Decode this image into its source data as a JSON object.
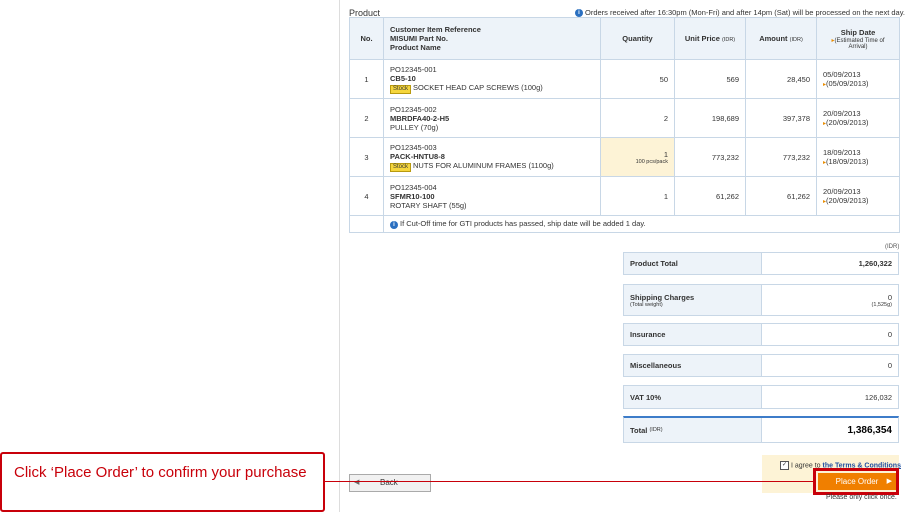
{
  "section_title": "Product",
  "notice": "Orders received after 16:30pm (Mon-Fri) and after 14pm (Sat) will be processed on the next day.",
  "table": {
    "headers": {
      "no": "No.",
      "ref_line1": "Customer Item Reference",
      "ref_line2": "MISUMI Part No.",
      "ref_line3": "Product Name",
      "quantity": "Quantity",
      "unit_price": "Unit Price",
      "unit_price_unit": "(IDR)",
      "amount": "Amount",
      "amount_unit": "(IDR)",
      "ship_date": "Ship Date",
      "ship_date_note": "(Estimated Time of Arrival)"
    },
    "rows": [
      {
        "no": "1",
        "ref": "PO12345-001",
        "part": "CB5-10",
        "stock": "Stock",
        "name": "SOCKET HEAD CAP SCREWS (100g)",
        "qty": "50",
        "pack": "",
        "unit_price": "569",
        "amount": "28,450",
        "ship": "05/09/2013",
        "eta": "(05/09/2013)"
      },
      {
        "no": "2",
        "ref": "PO12345-002",
        "part": "MBRDFA40-2-H5",
        "stock": "",
        "name": "PULLEY (70g)",
        "qty": "2",
        "pack": "",
        "unit_price": "198,689",
        "amount": "397,378",
        "ship": "20/09/2013",
        "eta": "(20/09/2013)"
      },
      {
        "no": "3",
        "ref": "PO12345-003",
        "part": "PACK-HNTU8-8",
        "stock": "Stock",
        "name": "NUTS FOR ALUMINUM FRAMES (1100g)",
        "qty": "1",
        "pack": "100 pcs/pack",
        "unit_price": "773,232",
        "amount": "773,232",
        "ship": "18/09/2013",
        "eta": "(18/09/2013)"
      },
      {
        "no": "4",
        "ref": "PO12345-004",
        "part": "SFMR10-100",
        "stock": "",
        "name": "ROTARY SHAFT (55g)",
        "qty": "1",
        "pack": "",
        "unit_price": "61,262",
        "amount": "61,262",
        "ship": "20/09/2013",
        "eta": "(20/09/2013)"
      }
    ],
    "footnote": "If Cut-Off time for GTI products has passed, ship date will be added 1 day."
  },
  "summary": {
    "currency": "(IDR)",
    "product_total_label": "Product Total",
    "product_total": "1,260,322",
    "shipping_label": "Shipping Charges",
    "shipping_sub": "(Total weight)",
    "shipping": "0",
    "weight": "(1,525g)",
    "insurance_label": "Insurance",
    "insurance": "0",
    "misc_label": "Miscellaneous",
    "misc": "0",
    "vat_label": "VAT 10%",
    "vat": "126,032",
    "total_label": "Total",
    "total_unit": "(IDR)",
    "total": "1,386,354"
  },
  "agree_prefix": "I agree to",
  "agree_link": "the Terms & Conditions",
  "place_order": "Place Order",
  "click_once": "Please only click once.",
  "back": "Back",
  "callout": "Click ‘Place Order’ to confirm your purchase",
  "colors": {
    "accent": "#f07f00",
    "highlight": "#c8000a",
    "header_bg": "#edf3f9",
    "link": "#1f4fa0"
  }
}
